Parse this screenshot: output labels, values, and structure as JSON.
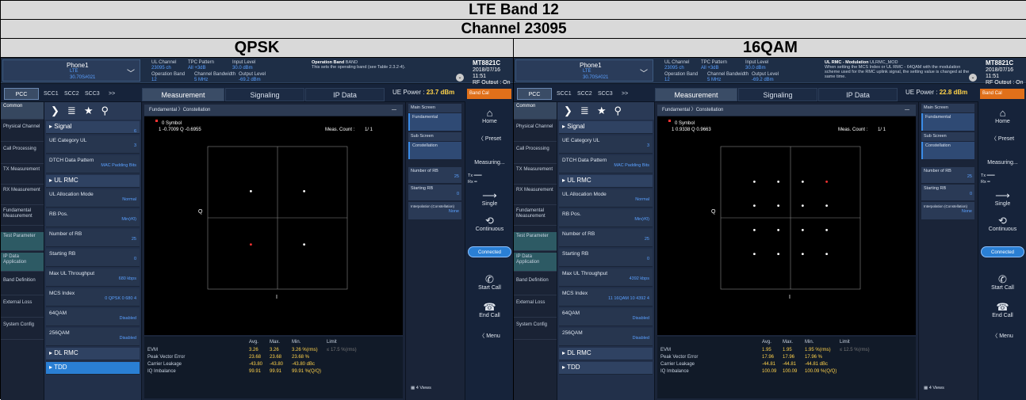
{
  "title": "LTE Band 12",
  "channel": "Channel 23095",
  "panels": [
    {
      "modulation": "QPSK",
      "phone": {
        "name": "Phone1",
        "tech": "LTE",
        "channel": "30.70S#021"
      },
      "params": {
        "ul_channel_label": "UL Channel",
        "ul_channel_value": "23095 ch",
        "tpc_label": "TPC Pattern",
        "tpc_value": "All +3dB",
        "input_label": "Input Level",
        "input_value": "30.0 dBm",
        "op_band_label": "Operation Band",
        "op_band_value": "12",
        "bw_label": "Channel Bandwidth",
        "bw_value": "5 MHz",
        "out_label": "Output Level",
        "out_value": "-69.2 dBm"
      },
      "desc_title": "Operation Band",
      "desc_tag": "BAND",
      "desc_text": "This sets the operating band (see Table 2.3.2-4).",
      "logo": "MT8821C",
      "logo_date": "2018/07/16 11:51",
      "logo_rf": "RF Output : On",
      "tabs": {
        "pcc": "PCC",
        "scc1": "SCC1",
        "scc2": "SCC2",
        "scc3": "SCC3",
        "more": ">>",
        "measurement": "Measurement",
        "signaling": "Signaling",
        "ipdata": "IP Data"
      },
      "ue_power_label": "UE Power :",
      "ue_power_value": "23.7 dBm",
      "band_call": "Band Cal",
      "nav": [
        "Common",
        "Physical Channel",
        "Call Processing",
        "TX Measurement",
        "RX Measurement",
        "Fundamental Measurement",
        "Test Parameter",
        "IP Data Application",
        "Band Definition",
        "External Loss",
        "System Config"
      ],
      "settings": [
        {
          "label": "Signal",
          "value": "6",
          "head": true
        },
        {
          "label": "UE Category UL",
          "value": "3"
        },
        {
          "label": "DTCH Data Pattern",
          "value": "MAC Padding Bits"
        },
        {
          "label": "UL RMC",
          "value": "",
          "head": true
        },
        {
          "label": "UL Allocation Mode",
          "value": "Normal"
        },
        {
          "label": "RB Pos.",
          "value": "Min(#0)"
        },
        {
          "label": "Number of RB",
          "value": "25"
        },
        {
          "label": "Starting RB",
          "value": "0"
        },
        {
          "label": "Max UL Throughput",
          "value": "680 kbps"
        },
        {
          "label": "MCS Index",
          "value": "0 QPSK 0 680 4"
        },
        {
          "label": "64QAM",
          "value": "Disabled"
        },
        {
          "label": "256QAM",
          "value": "Disabled"
        },
        {
          "label": "DL RMC",
          "value": "",
          "head": true
        },
        {
          "label": "TDD",
          "value": "",
          "head": true,
          "tdd": true
        }
      ],
      "breadcrumb": "Fundamental 〉Constellation",
      "symbol_label": "0 Symbol",
      "symbol_value": "1 -0.7009 Q -0.6955",
      "meas_count_label": "Meas. Count :",
      "meas_count_value": "1/ 1",
      "axis_q": "Q",
      "axis_i": "I",
      "table_headers": [
        "Avg.",
        "Max.",
        "Min.",
        "Limit"
      ],
      "table_rows": [
        {
          "name": "EVM",
          "avg": "3.26",
          "max": "3.26",
          "min": "3.26 %(rms)",
          "limit": "≤ 17.5 %(rms)"
        },
        {
          "name": "Peak Vector Error",
          "avg": "23.68",
          "max": "23.68",
          "min": "23.68 %",
          "limit": ""
        },
        {
          "name": "Carrier Leakage",
          "avg": "-43.80",
          "max": "-43.80",
          "min": "-43.80 dBc",
          "limit": ""
        },
        {
          "name": "IQ Imbalance",
          "avg": "99.91",
          "max": "99.91",
          "min": "99.91 %(Q/Q)",
          "limit": ""
        }
      ],
      "right": {
        "main_screen": "Main Screen",
        "fundamental": "Fundamental",
        "sub_screen": "Sub Screen",
        "constellation": "Constellation",
        "num_rb": "Number of RB",
        "num_rb_value": "25",
        "starting_rb": "Starting RB",
        "starting_rb_value": "0",
        "interp": "Interpolation (Constellation)",
        "interp_value": "None",
        "views": "4 Views"
      },
      "far": {
        "home": "Home",
        "preset": "Preset",
        "measuring": "Measuring...",
        "tx": "Tx",
        "rx": "Rx",
        "single": "Single",
        "continuous": "Continuous",
        "connected": "Connected",
        "start_call": "Start Call",
        "end_call": "End Call",
        "menu": "Menu"
      }
    },
    {
      "modulation": "16QAM",
      "phone": {
        "name": "Phone1",
        "tech": "LTE",
        "channel": "30.70S#021"
      },
      "params": {
        "ul_channel_label": "UL Channel",
        "ul_channel_value": "23095 ch",
        "tpc_label": "TPC Pattern",
        "tpc_value": "All +3dB",
        "input_label": "Input Level",
        "input_value": "30.0 dBm",
        "op_band_label": "Operation Band",
        "op_band_value": "12",
        "bw_label": "Channel Bandwidth",
        "bw_value": "5 MHz",
        "out_label": "Output Level",
        "out_value": "-69.2 dBm"
      },
      "desc_title": "UL RMC - Modulation",
      "desc_tag": "ULRMC_MOD",
      "desc_text": "When setting the MCS Index or UL RMC - 64QAM with the modulation scheme used for the RMC uplink signal, the setting value is changed at the same time.",
      "logo": "MT8821C",
      "logo_date": "2018/07/16 11:51",
      "logo_rf": "RF Output : On",
      "tabs": {
        "pcc": "PCC",
        "scc1": "SCC1",
        "scc2": "SCC2",
        "scc3": "SCC3",
        "more": ">>",
        "measurement": "Measurement",
        "signaling": "Signaling",
        "ipdata": "IP Data"
      },
      "ue_power_label": "UE Power :",
      "ue_power_value": "22.8 dBm",
      "band_call": "Band Cal",
      "nav": [
        "Common",
        "Physical Channel",
        "Call Processing",
        "TX Measurement",
        "RX Measurement",
        "Fundamental Measurement",
        "Test Parameter",
        "IP Data Application",
        "Band Definition",
        "External Loss",
        "System Config"
      ],
      "settings": [
        {
          "label": "Signal",
          "value": "",
          "head": true
        },
        {
          "label": "UE Category UL",
          "value": "3"
        },
        {
          "label": "DTCH Data Pattern",
          "value": "MAC Padding Bits"
        },
        {
          "label": "UL RMC",
          "value": "",
          "head": true
        },
        {
          "label": "UL Allocation Mode",
          "value": "Normal"
        },
        {
          "label": "RB Pos.",
          "value": "Min(#0)"
        },
        {
          "label": "Number of RB",
          "value": "25"
        },
        {
          "label": "Starting RB",
          "value": "0"
        },
        {
          "label": "Max UL Throughput",
          "value": "4392 kbps"
        },
        {
          "label": "MCS Index",
          "value": "11 16QAM 10 4392 4"
        },
        {
          "label": "64QAM",
          "value": "Disabled"
        },
        {
          "label": "256QAM",
          "value": "Disabled"
        },
        {
          "label": "DL RMC",
          "value": "",
          "head": true
        },
        {
          "label": "TDD",
          "value": "",
          "head": true,
          "tdd": false
        }
      ],
      "breadcrumb": "Fundamental 〉Constellation",
      "symbol_label": "0 Symbol",
      "symbol_value": "1 0.9338 Q 0.9663",
      "meas_count_label": "Meas. Count :",
      "meas_count_value": "1/ 1",
      "axis_q": "Q",
      "axis_i": "I",
      "table_headers": [
        "Avg.",
        "Max.",
        "Min.",
        "Limit"
      ],
      "table_rows": [
        {
          "name": "EVM",
          "avg": "1.95",
          "max": "1.95",
          "min": "1.95 %(rms)",
          "limit": "≤ 12.5 %(rms)"
        },
        {
          "name": "Peak Vector Error",
          "avg": "17.96",
          "max": "17.96",
          "min": "17.96 %",
          "limit": ""
        },
        {
          "name": "Carrier Leakage",
          "avg": "-44.81",
          "max": "-44.81",
          "min": "-44.81 dBc",
          "limit": ""
        },
        {
          "name": "IQ Imbalance",
          "avg": "100.09",
          "max": "100.09",
          "min": "100.09 %(Q/Q)",
          "limit": ""
        }
      ],
      "right": {
        "main_screen": "Main Screen",
        "fundamental": "Fundamental",
        "sub_screen": "Sub Screen",
        "constellation": "Constellation",
        "num_rb": "Number of RB",
        "num_rb_value": "25",
        "starting_rb": "Starting RB",
        "starting_rb_value": "0",
        "interp": "Interpolation (Constellation)",
        "interp_value": "None",
        "views": "4 Views"
      },
      "far": {
        "home": "Home",
        "preset": "Preset",
        "measuring": "Measuring...",
        "tx": "Tx",
        "rx": "Rx",
        "single": "Single",
        "continuous": "Continuous",
        "connected": "Connected",
        "start_call": "Start Call",
        "end_call": "End Call",
        "menu": "Menu"
      }
    }
  ]
}
